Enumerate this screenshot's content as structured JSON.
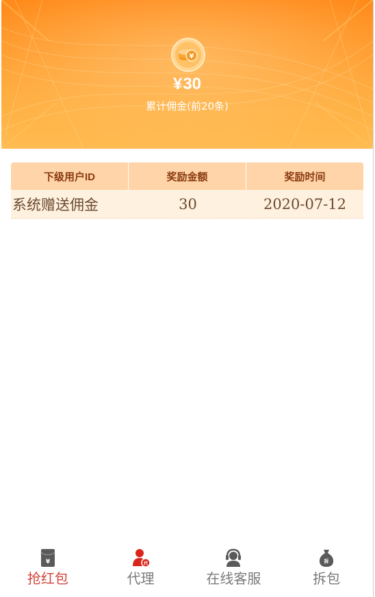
{
  "summary": {
    "currency_symbol": "¥",
    "amount": "30",
    "label": "累计佣金(前20条)"
  },
  "table": {
    "headers": [
      "下级用户ID",
      "奖励金额",
      "奖励时间"
    ],
    "rows": [
      [
        "系统赠送佣金",
        "30",
        "2020-07-12"
      ]
    ]
  },
  "nav": {
    "items": [
      {
        "label": "抢红包",
        "icon": "red-packet-icon",
        "active": true
      },
      {
        "label": "代理",
        "icon": "agent-user-icon",
        "active": false
      },
      {
        "label": "在线客服",
        "icon": "customer-service-icon",
        "active": false
      },
      {
        "label": "拆包",
        "icon": "money-bag-icon",
        "active": false
      }
    ]
  },
  "colors": {
    "banner_top": "#ff8a1a",
    "banner_bottom": "#ffbb52",
    "header_bg": "#ffd4a8",
    "row_bg": "#fff1df",
    "active_nav": "#d0453c",
    "inactive_nav": "#7a7a7a"
  }
}
